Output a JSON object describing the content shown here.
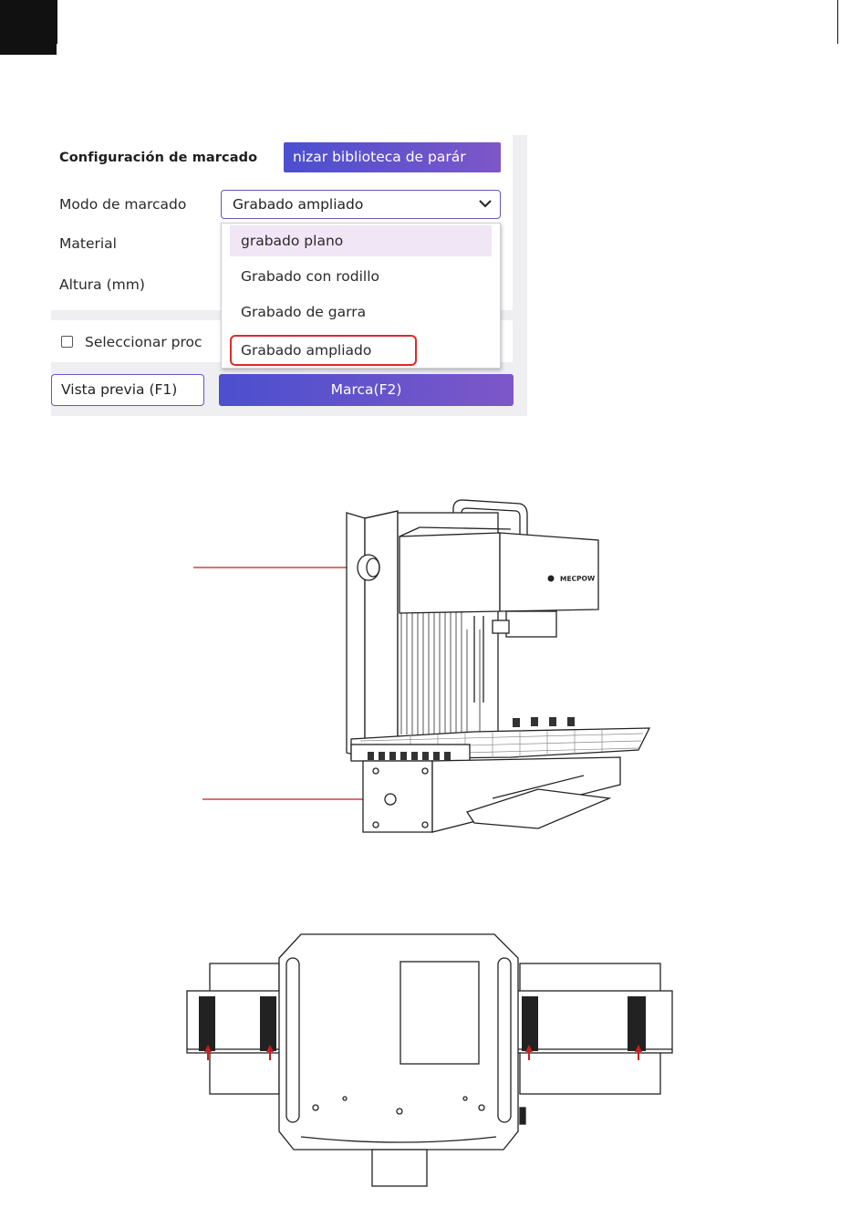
{
  "panel": {
    "section_title": "Configuración de marcado",
    "library_button_label": "nizar biblioteca de parár",
    "mode_label": "Modo de marcado",
    "mode_value": "Grabado ampliado",
    "material_label": "Material",
    "height_label": "Altura (mm)",
    "dropdown_options": [
      "grabado plano",
      "Grabado con rodillo",
      "Grabado de garra",
      "Grabado ampliado"
    ],
    "select_process_label": "Seleccionar proc",
    "preview_button_label": "Vista previa (F1)",
    "mark_button_label": "Marca(F2)"
  },
  "machine": {
    "brand_text": "MECPOW"
  },
  "colors": {
    "accent_start": "#4b4fcf",
    "accent_end": "#7d57c8",
    "highlight_box": "#dd2a2a",
    "callout_line": "#c81e1e",
    "hover_option": "#f1e6f6"
  }
}
